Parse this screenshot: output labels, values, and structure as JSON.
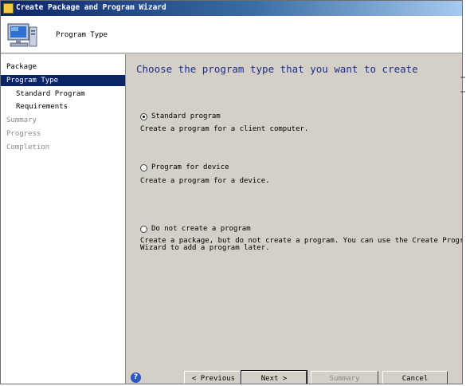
{
  "window": {
    "title": "Create Package and Program Wizard"
  },
  "header": {
    "title": "Program Type",
    "icon": "computer-icon"
  },
  "sidebar": {
    "items": [
      {
        "label": "Package",
        "state": "normal",
        "level": 0
      },
      {
        "label": "Program Type",
        "state": "active",
        "level": 0
      },
      {
        "label": "Standard Program",
        "state": "normal",
        "level": 1
      },
      {
        "label": "Requirements",
        "state": "normal",
        "level": 1
      },
      {
        "label": "Summary",
        "state": "disabled",
        "level": 0
      },
      {
        "label": "Progress",
        "state": "disabled",
        "level": 0
      },
      {
        "label": "Completion",
        "state": "disabled",
        "level": 0
      }
    ]
  },
  "main": {
    "heading": "Choose the program type that you want to create",
    "options": [
      {
        "label": "Standard program",
        "selected": true,
        "description": [
          "Create a program for a client computer."
        ]
      },
      {
        "label": "Program for device",
        "selected": false,
        "description": [
          "Create a program for a device."
        ]
      },
      {
        "label": "Do not create a program",
        "selected": false,
        "description": [
          "Create a package, but do not create a program. You can use the Create Program",
          "Wizard to add a program later."
        ]
      }
    ]
  },
  "footer": {
    "help": "?",
    "previous": "< Previous",
    "next": "Next >",
    "summary": "Summary",
    "cancel": "Cancel"
  },
  "colors": {
    "title_bar_start": "#0a246a",
    "title_bar_end": "#a6caf0",
    "heading": "#1c2f8c",
    "active_nav": "#0a246a",
    "panel": "#d4d0c8"
  }
}
